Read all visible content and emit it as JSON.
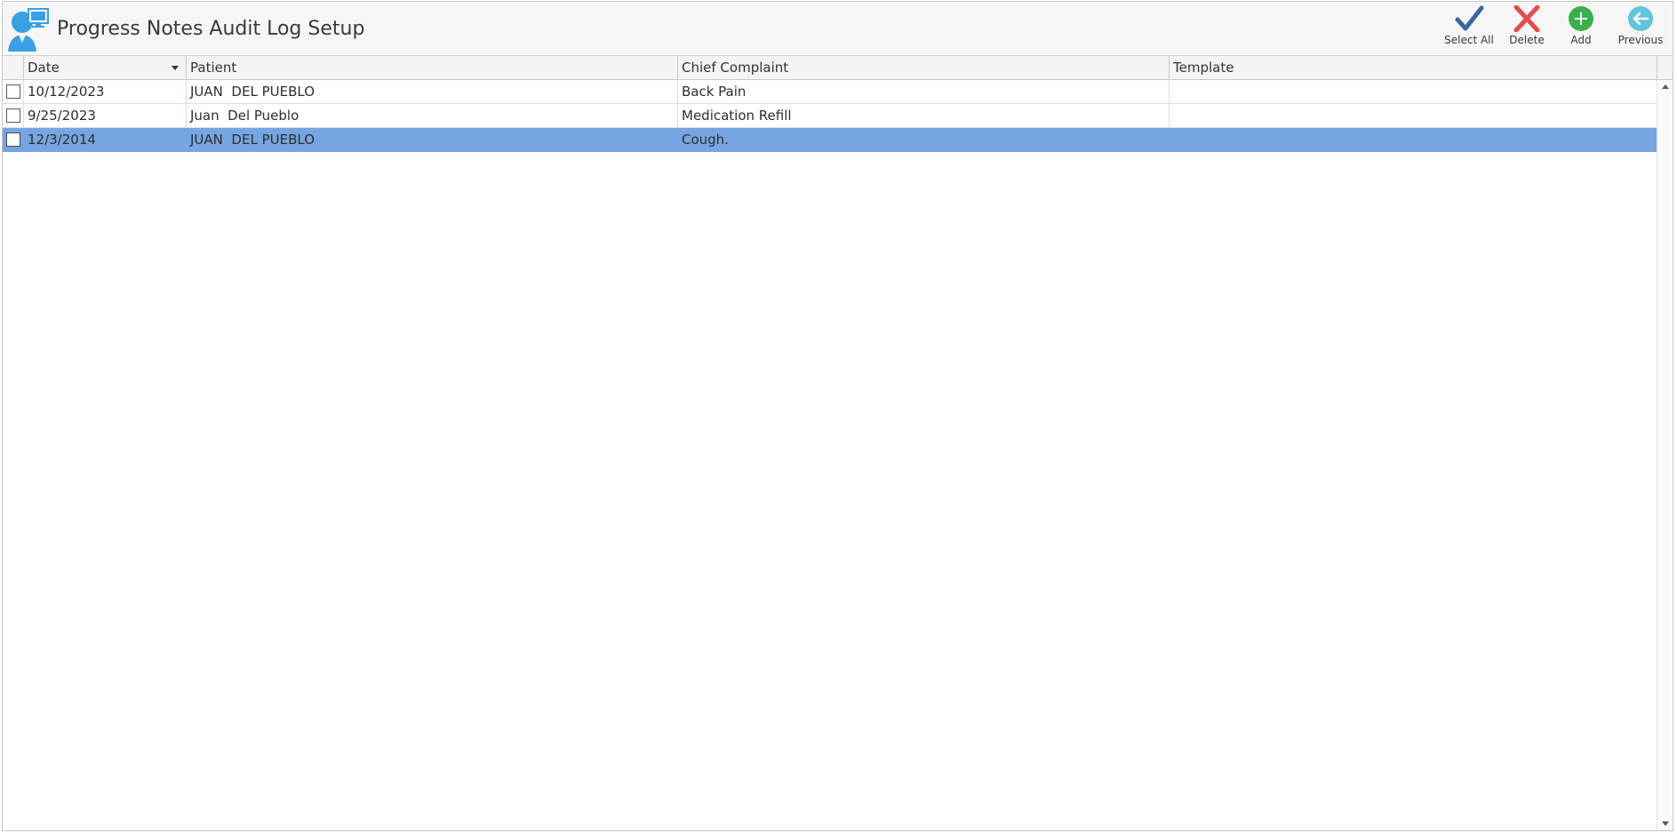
{
  "window": {
    "title": "Progress Notes Audit Log Setup"
  },
  "toolbar": {
    "select_all": "Select All",
    "delete": "Delete",
    "add": "Add",
    "previous": "Previous"
  },
  "colors": {
    "select_all": "#3a66a8",
    "delete": "#e84a4a",
    "add": "#3ab04a",
    "previous": "#62c4dc",
    "selected_row": "#76a5e1"
  },
  "grid": {
    "columns": [
      "Date",
      "Patient",
      "Chief Complaint",
      "Template"
    ],
    "rows": [
      {
        "date": "10/12/2023",
        "patient": "JUAN  DEL PUEBLO",
        "complaint": "Back Pain",
        "template": ""
      },
      {
        "date": "9/25/2023",
        "patient": "Juan  Del Pueblo",
        "complaint": "Medication Refill",
        "template": ""
      },
      {
        "date": "12/3/2014",
        "patient": "JUAN  DEL PUEBLO",
        "complaint": "Cough.",
        "template": "",
        "selected": true
      }
    ]
  }
}
